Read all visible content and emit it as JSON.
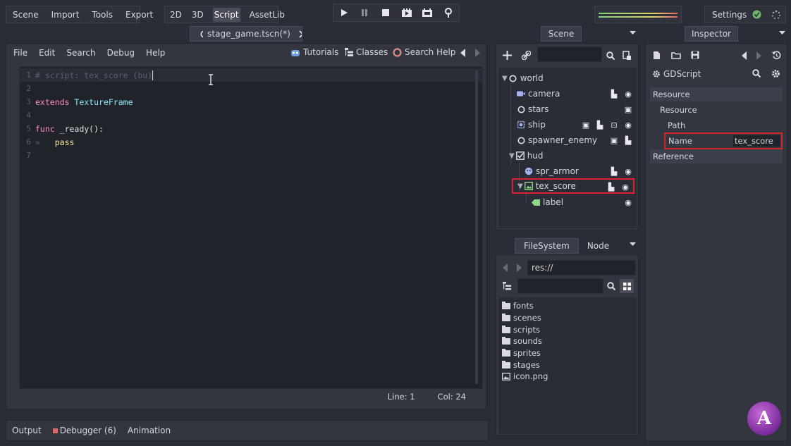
{
  "top_menu": {
    "items": [
      "Scene",
      "Import",
      "Tools",
      "Export"
    ]
  },
  "workspace": {
    "items": [
      "2D",
      "3D",
      "Script",
      "AssetLib"
    ],
    "active": "Script"
  },
  "play_bar": {
    "icons": [
      "play-icon",
      "pause-icon",
      "stop-icon",
      "play-scene-icon",
      "play-custom-icon",
      "remote-debug-icon"
    ]
  },
  "settings": {
    "label": "Settings",
    "status_icon": "check-circle-icon",
    "spinner_icon": "spinner-icon"
  },
  "script_tab": {
    "label": "stage_game.tscn(*)"
  },
  "script_menu": {
    "items": [
      "File",
      "Edit",
      "Search",
      "Debug",
      "Help"
    ],
    "tutorials": "Tutorials",
    "classes": "Classes",
    "search_help": "Search Help"
  },
  "editor": {
    "lines": [
      {
        "n": "1",
        "text": "# script: tex_score (bu)"
      },
      {
        "n": "2",
        "text": ""
      },
      {
        "n": "3",
        "kw": "extends",
        "cls": "TextureFrame"
      },
      {
        "n": "4",
        "text": ""
      },
      {
        "n": "5",
        "kw": "func",
        "fn": "_ready():"
      },
      {
        "n": "6",
        "arrow": "»",
        "kw2": "pass"
      },
      {
        "n": "7",
        "text": ""
      }
    ],
    "status": {
      "line": "Line: 1",
      "col": "Col: 24"
    }
  },
  "bottom_bar": {
    "output": "Output",
    "debugger": "Debugger (6)",
    "animation": "Animation"
  },
  "scene_dock": {
    "tab": "Scene",
    "nodes": [
      {
        "name": "world",
        "icon": "node-circle-icon"
      },
      {
        "name": "camera",
        "icon": "camera-icon"
      },
      {
        "name": "stars",
        "icon": "node-circle-icon"
      },
      {
        "name": "ship",
        "icon": "sprite-icon"
      },
      {
        "name": "spawner_enemy",
        "icon": "node-circle-icon"
      },
      {
        "name": "hud",
        "icon": "control-icon"
      },
      {
        "name": "spr_armor",
        "icon": "sprite-icon"
      },
      {
        "name": "tex_score",
        "icon": "texture-frame-icon"
      },
      {
        "name": "label",
        "icon": "label-icon"
      }
    ]
  },
  "filesystem_dock": {
    "tabs": [
      "FileSystem",
      "Node"
    ],
    "path": "res://",
    "items": [
      {
        "name": "fonts",
        "icon": "folder-icon"
      },
      {
        "name": "scenes",
        "icon": "folder-icon"
      },
      {
        "name": "scripts",
        "icon": "folder-icon"
      },
      {
        "name": "sounds",
        "icon": "folder-icon"
      },
      {
        "name": "sprites",
        "icon": "folder-icon"
      },
      {
        "name": "stages",
        "icon": "folder-icon"
      },
      {
        "name": "icon.png",
        "icon": "image-icon"
      }
    ]
  },
  "inspector": {
    "tab": "Inspector",
    "object": "GDScript",
    "rows": {
      "resource_header": "Resource",
      "resource_sub": "Resource",
      "path": "Path",
      "name_label": "Name",
      "name_value": "tex_score",
      "reference": "Reference"
    }
  },
  "logo": {
    "text": "A"
  }
}
